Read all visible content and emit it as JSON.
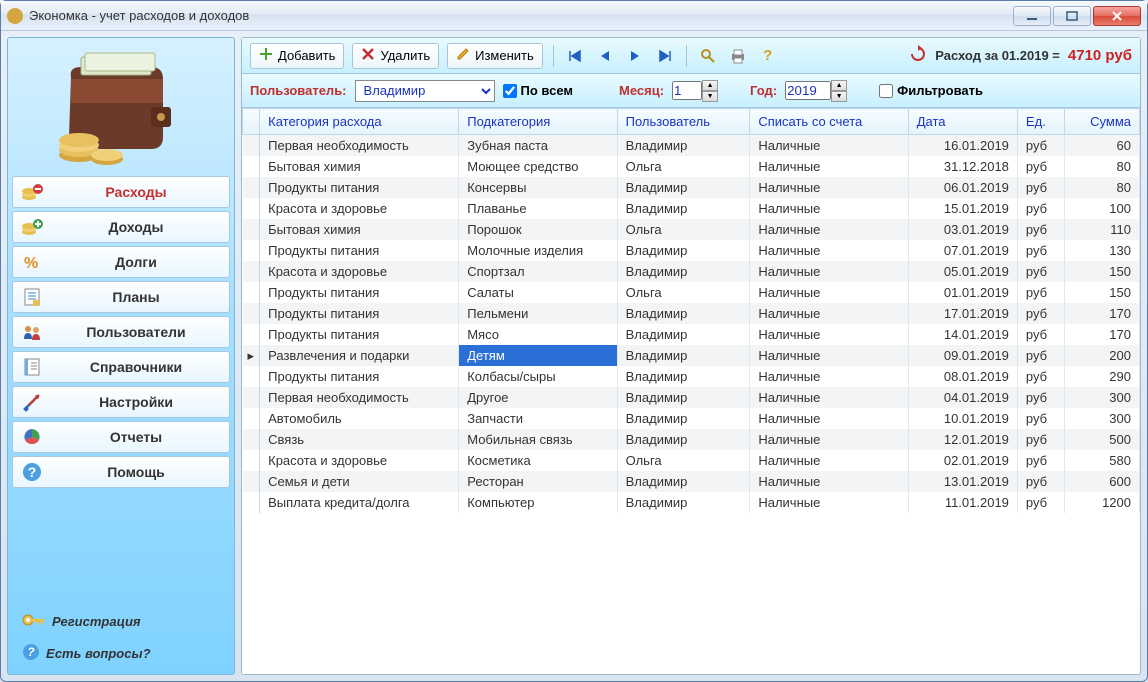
{
  "window": {
    "title": "Экономка - учет расходов и доходов"
  },
  "sidebar": {
    "items": [
      {
        "label": "Расходы",
        "icon": "coins-minus"
      },
      {
        "label": "Доходы",
        "icon": "coins-plus"
      },
      {
        "label": "Долги",
        "icon": "percent"
      },
      {
        "label": "Планы",
        "icon": "note"
      },
      {
        "label": "Пользователи",
        "icon": "users"
      },
      {
        "label": "Справочники",
        "icon": "book"
      },
      {
        "label": "Настройки",
        "icon": "tools"
      },
      {
        "label": "Отчеты",
        "icon": "pie"
      },
      {
        "label": "Помощь",
        "icon": "help"
      }
    ],
    "register": "Регистрация",
    "questions": "Есть вопросы?"
  },
  "toolbar": {
    "add": "Добавить",
    "delete": "Удалить",
    "edit": "Изменить",
    "summary_label": "Расход за 01.2019 =",
    "summary_value": "4710 руб"
  },
  "filter": {
    "user_label": "Пользователь:",
    "user_value": "Владимир",
    "all_label": "По всем",
    "all_checked": true,
    "month_label": "Месяц:",
    "month_value": "1",
    "year_label": "Год:",
    "year_value": "2019",
    "filter_label": "Фильтровать",
    "filter_checked": false
  },
  "columns": {
    "category": "Категория расхода",
    "subcategory": "Подкатегория",
    "user": "Пользователь",
    "account": "Списать со счета",
    "date": "Дата",
    "unit": "Ед.",
    "sum": "Сумма"
  },
  "selected_row_index": 10,
  "rows": [
    {
      "category": "Первая необходимость",
      "subcategory": "Зубная паста",
      "user": "Владимир",
      "account": "Наличные",
      "date": "16.01.2019",
      "unit": "руб",
      "sum": "60"
    },
    {
      "category": "Бытовая химия",
      "subcategory": "Моющее средство",
      "user": "Ольга",
      "account": "Наличные",
      "date": "31.12.2018",
      "unit": "руб",
      "sum": "80"
    },
    {
      "category": "Продукты питания",
      "subcategory": "Консервы",
      "user": "Владимир",
      "account": "Наличные",
      "date": "06.01.2019",
      "unit": "руб",
      "sum": "80"
    },
    {
      "category": "Красота и здоровье",
      "subcategory": "Плаванье",
      "user": "Владимир",
      "account": "Наличные",
      "date": "15.01.2019",
      "unit": "руб",
      "sum": "100"
    },
    {
      "category": "Бытовая химия",
      "subcategory": "Порошок",
      "user": "Ольга",
      "account": "Наличные",
      "date": "03.01.2019",
      "unit": "руб",
      "sum": "110"
    },
    {
      "category": "Продукты питания",
      "subcategory": "Молочные изделия",
      "user": "Владимир",
      "account": "Наличные",
      "date": "07.01.2019",
      "unit": "руб",
      "sum": "130"
    },
    {
      "category": "Красота и здоровье",
      "subcategory": "Спортзал",
      "user": "Владимир",
      "account": "Наличные",
      "date": "05.01.2019",
      "unit": "руб",
      "sum": "150"
    },
    {
      "category": "Продукты питания",
      "subcategory": "Салаты",
      "user": "Ольга",
      "account": "Наличные",
      "date": "01.01.2019",
      "unit": "руб",
      "sum": "150"
    },
    {
      "category": "Продукты питания",
      "subcategory": "Пельмени",
      "user": "Владимир",
      "account": "Наличные",
      "date": "17.01.2019",
      "unit": "руб",
      "sum": "170"
    },
    {
      "category": "Продукты питания",
      "subcategory": "Мясо",
      "user": "Владимир",
      "account": "Наличные",
      "date": "14.01.2019",
      "unit": "руб",
      "sum": "170"
    },
    {
      "category": "Развлечения и подарки",
      "subcategory": "Детям",
      "user": "Владимир",
      "account": "Наличные",
      "date": "09.01.2019",
      "unit": "руб",
      "sum": "200"
    },
    {
      "category": "Продукты питания",
      "subcategory": "Колбасы/сыры",
      "user": "Владимир",
      "account": "Наличные",
      "date": "08.01.2019",
      "unit": "руб",
      "sum": "290"
    },
    {
      "category": "Первая необходимость",
      "subcategory": "Другое",
      "user": "Владимир",
      "account": "Наличные",
      "date": "04.01.2019",
      "unit": "руб",
      "sum": "300"
    },
    {
      "category": "Автомобиль",
      "subcategory": "Запчасти",
      "user": "Владимир",
      "account": "Наличные",
      "date": "10.01.2019",
      "unit": "руб",
      "sum": "300"
    },
    {
      "category": "Связь",
      "subcategory": "Мобильная связь",
      "user": "Владимир",
      "account": "Наличные",
      "date": "12.01.2019",
      "unit": "руб",
      "sum": "500"
    },
    {
      "category": "Красота и здоровье",
      "subcategory": "Косметика",
      "user": "Ольга",
      "account": "Наличные",
      "date": "02.01.2019",
      "unit": "руб",
      "sum": "580"
    },
    {
      "category": "Семья и дети",
      "subcategory": "Ресторан",
      "user": "Владимир",
      "account": "Наличные",
      "date": "13.01.2019",
      "unit": "руб",
      "sum": "600"
    },
    {
      "category": "Выплата кредита/долга",
      "subcategory": "Компьютер",
      "user": "Владимир",
      "account": "Наличные",
      "date": "11.01.2019",
      "unit": "руб",
      "sum": "1200"
    }
  ]
}
